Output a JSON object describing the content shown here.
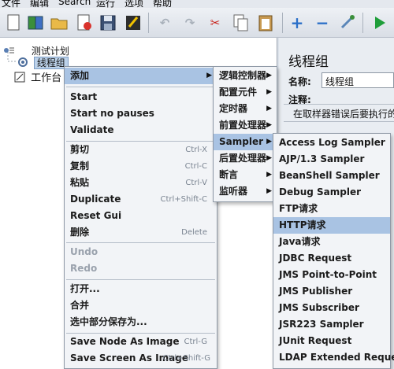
{
  "menubar": {
    "items": [
      "文件",
      "编辑",
      "Search",
      "运行",
      "选项",
      "帮助"
    ]
  },
  "toolbar": {
    "icons": [
      "new-icon",
      "templates-icon",
      "open-icon",
      "close-icon",
      "save-icon",
      "save-as-icon",
      "undo-icon",
      "redo-icon",
      "cut-icon",
      "copy-icon",
      "paste-icon",
      "expand-icon",
      "collapse-icon",
      "toggle-icon",
      "start-icon"
    ]
  },
  "tree": {
    "test_plan": "测试计划",
    "thread_group": "线程组",
    "workbench": "工作台"
  },
  "right_panel": {
    "title": "线程组",
    "name_label": "名称:",
    "name_value": "线程组",
    "comment_label": "注释:",
    "error_text": "在取样器错误后要执行的"
  },
  "context_menu": {
    "add": "添加",
    "start": "Start",
    "start_no_pauses": "Start no pauses",
    "validate": "Validate",
    "cut": "剪切",
    "cut_acc": "Ctrl-X",
    "copy": "复制",
    "copy_acc": "Ctrl-C",
    "paste": "粘贴",
    "paste_acc": "Ctrl-V",
    "duplicate": "Duplicate",
    "duplicate_acc": "Ctrl+Shift-C",
    "reset_gui": "Reset Gui",
    "delete": "删除",
    "delete_acc": "Delete",
    "undo": "Undo",
    "redo": "Redo",
    "open": "打开...",
    "merge": "合并",
    "save_selection": "选中部分保存为...",
    "save_node_image": "Save Node As Image",
    "save_node_image_acc": "Ctrl-G",
    "save_screen_image": "Save Screen As Image",
    "save_screen_image_acc": "Ctrl+Shift-G"
  },
  "add_menu": {
    "logic_controller": "逻辑控制器",
    "config_element": "配置元件",
    "timer": "定时器",
    "pre_processor": "前置处理器",
    "sampler": "Sampler",
    "post_processor": "后置处理器",
    "assertion": "断言",
    "listener": "监听器"
  },
  "sampler_menu": {
    "items": [
      "Access Log Sampler",
      "AJP/1.3 Sampler",
      "BeanShell Sampler",
      "Debug Sampler",
      "FTP请求",
      "HTTP请求",
      "Java请求",
      "JDBC Request",
      "JMS Point-to-Point",
      "JMS Publisher",
      "JMS Subscriber",
      "JSR223 Sampler",
      "JUnit Request",
      "LDAP Extended Request"
    ],
    "highlighted": "HTTP请求"
  }
}
